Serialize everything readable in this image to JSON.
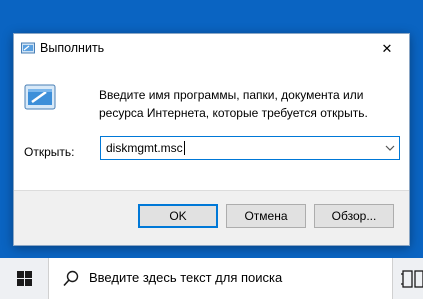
{
  "dialog": {
    "title": "Выполнить",
    "close_glyph": "✕",
    "icon": "run-icon",
    "description": "Введите имя программы, папки, документа или ресурса Интернета, которые требуется открыть.",
    "open_label": "Открыть:",
    "open_value": "diskmgmt.msc",
    "buttons": {
      "ok": "OK",
      "cancel": "Отмена",
      "browse": "Обзор..."
    }
  },
  "taskbar": {
    "search_placeholder": "Введите здесь текст для поиска",
    "start_icon": "windows-logo-icon",
    "search_icon": "search-icon",
    "task_view_icon": "task-view-icon"
  },
  "colors": {
    "desktop": "#0a64c2",
    "accent": "#0078d7",
    "button_face": "#e1e1e1",
    "footer": "#f0f0f0",
    "taskbar": "#eef0f3"
  }
}
